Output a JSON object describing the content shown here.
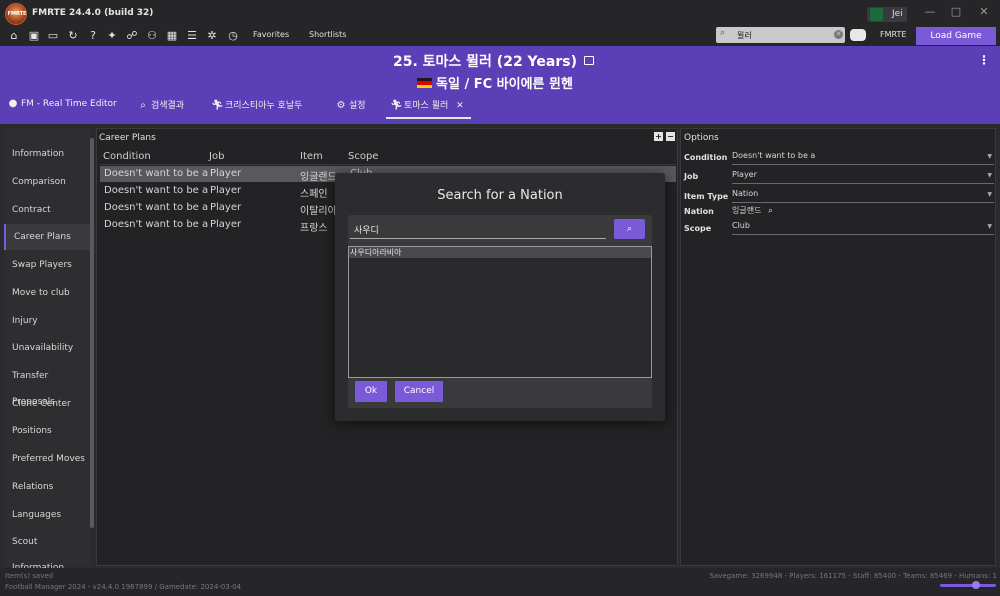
{
  "window": {
    "title": "FMRTE 24.4.0 (build 32)",
    "logo_text": "FMRTE",
    "user": "Jei",
    "controls": [
      "—",
      "□",
      "✕"
    ]
  },
  "toolbar": {
    "favorites": "Favorites",
    "shortlists": "Shortlists",
    "search_value": "뮐러",
    "fmrte": "FMRTE",
    "load_game": "Load Game"
  },
  "header": {
    "player_title": "25. 토마스 뮐러 (22 Years)",
    "subtitle": "독일 / FC 바이에른 뮌헨",
    "flag_colors": [
      "#1a1a1a",
      "#dd0000",
      "#ffce00"
    ],
    "tabs": [
      {
        "icon": "❓",
        "label": "FM - Real Time Editor"
      },
      {
        "icon": "🔍",
        "label": "검색결과"
      },
      {
        "icon": "🏃",
        "label": "크리스티아누 호날두"
      },
      {
        "icon": "⚙",
        "label": "설정"
      },
      {
        "icon": "🏃",
        "label": "토마스 뮐러"
      }
    ],
    "active_tab_close": "✕"
  },
  "sidebar": {
    "items": [
      "Information",
      "Comparison",
      "Contract",
      "Career Plans",
      "Swap Players",
      "Move to club",
      "Injury",
      "Unavailability",
      "Transfer Proposals",
      "Clone Center",
      "Positions",
      "Preferred Moves",
      "Relations",
      "Languages",
      "Scout Information"
    ],
    "active": "Career Plans"
  },
  "career_plans": {
    "title": "Career Plans",
    "columns": [
      "Condition",
      "Job",
      "Item",
      "Scope"
    ],
    "rows": [
      {
        "condition": "Doesn't want to be a",
        "job": "Player",
        "item": "잉글랜드",
        "scope": "Club"
      },
      {
        "condition": "Doesn't want to be a",
        "job": "Player",
        "item": "스페인",
        "scope": ""
      },
      {
        "condition": "Doesn't want to be a",
        "job": "Player",
        "item": "이탈리아",
        "scope": ""
      },
      {
        "condition": "Doesn't want to be a",
        "job": "Player",
        "item": "프랑스",
        "scope": ""
      }
    ],
    "add_label": "+",
    "remove_label": "−"
  },
  "options": {
    "title": "Options",
    "fields": [
      {
        "label": "Condition",
        "value": "Doesn't want to be a"
      },
      {
        "label": "Job",
        "value": "Player"
      },
      {
        "label": "Item Type",
        "value": "Nation"
      },
      {
        "label": "Nation",
        "value": "잉글랜드"
      },
      {
        "label": "Scope",
        "value": "Club"
      }
    ]
  },
  "modal": {
    "title": "Search for a Nation",
    "search_value": "사우디",
    "results": [
      "사우디아라비아"
    ],
    "ok_label": "Ok",
    "cancel_label": "Cancel"
  },
  "status": {
    "line1": "Item(s) saved",
    "line2": "Football Manager 2024 - v24.4.0 1967899 / Gamedate: 2024-03-04",
    "right": "Savegame: 3269948 - Players: 161175 - Staff: 85400 - Teams: 85469 - Humans: 1"
  }
}
